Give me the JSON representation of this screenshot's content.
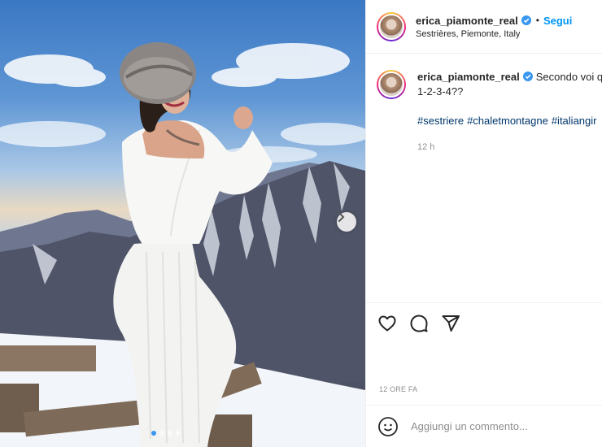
{
  "post": {
    "username": "erica_piamonte_real",
    "verified": true,
    "separator": "•",
    "follow_label": "Segui",
    "location": "Sestrières, Piemonte, Italy"
  },
  "caption": {
    "username": "erica_piamonte_real",
    "text_line1": "Secondo voi qu",
    "text_line2": "1-2-3-4??",
    "hashtags": [
      "#sestriere",
      "#chaletmontagne",
      "#italiangir"
    ],
    "time": "12 h"
  },
  "media": {
    "carousel_total": 4,
    "carousel_active": 1
  },
  "footer": {
    "age": "12 ORE FA",
    "comment_placeholder": "Aggiungi un commento..."
  },
  "icons": {
    "like": "heart-icon",
    "comment": "comment-icon",
    "share": "share-icon",
    "emoji": "emoji-icon",
    "verified": "verified-badge-icon",
    "next": "chevron-right-icon"
  },
  "colors": {
    "accent": "#0095f6",
    "hashtag": "#00376b",
    "muted": "#8e8e8e",
    "active_dot": "#3897f0"
  }
}
